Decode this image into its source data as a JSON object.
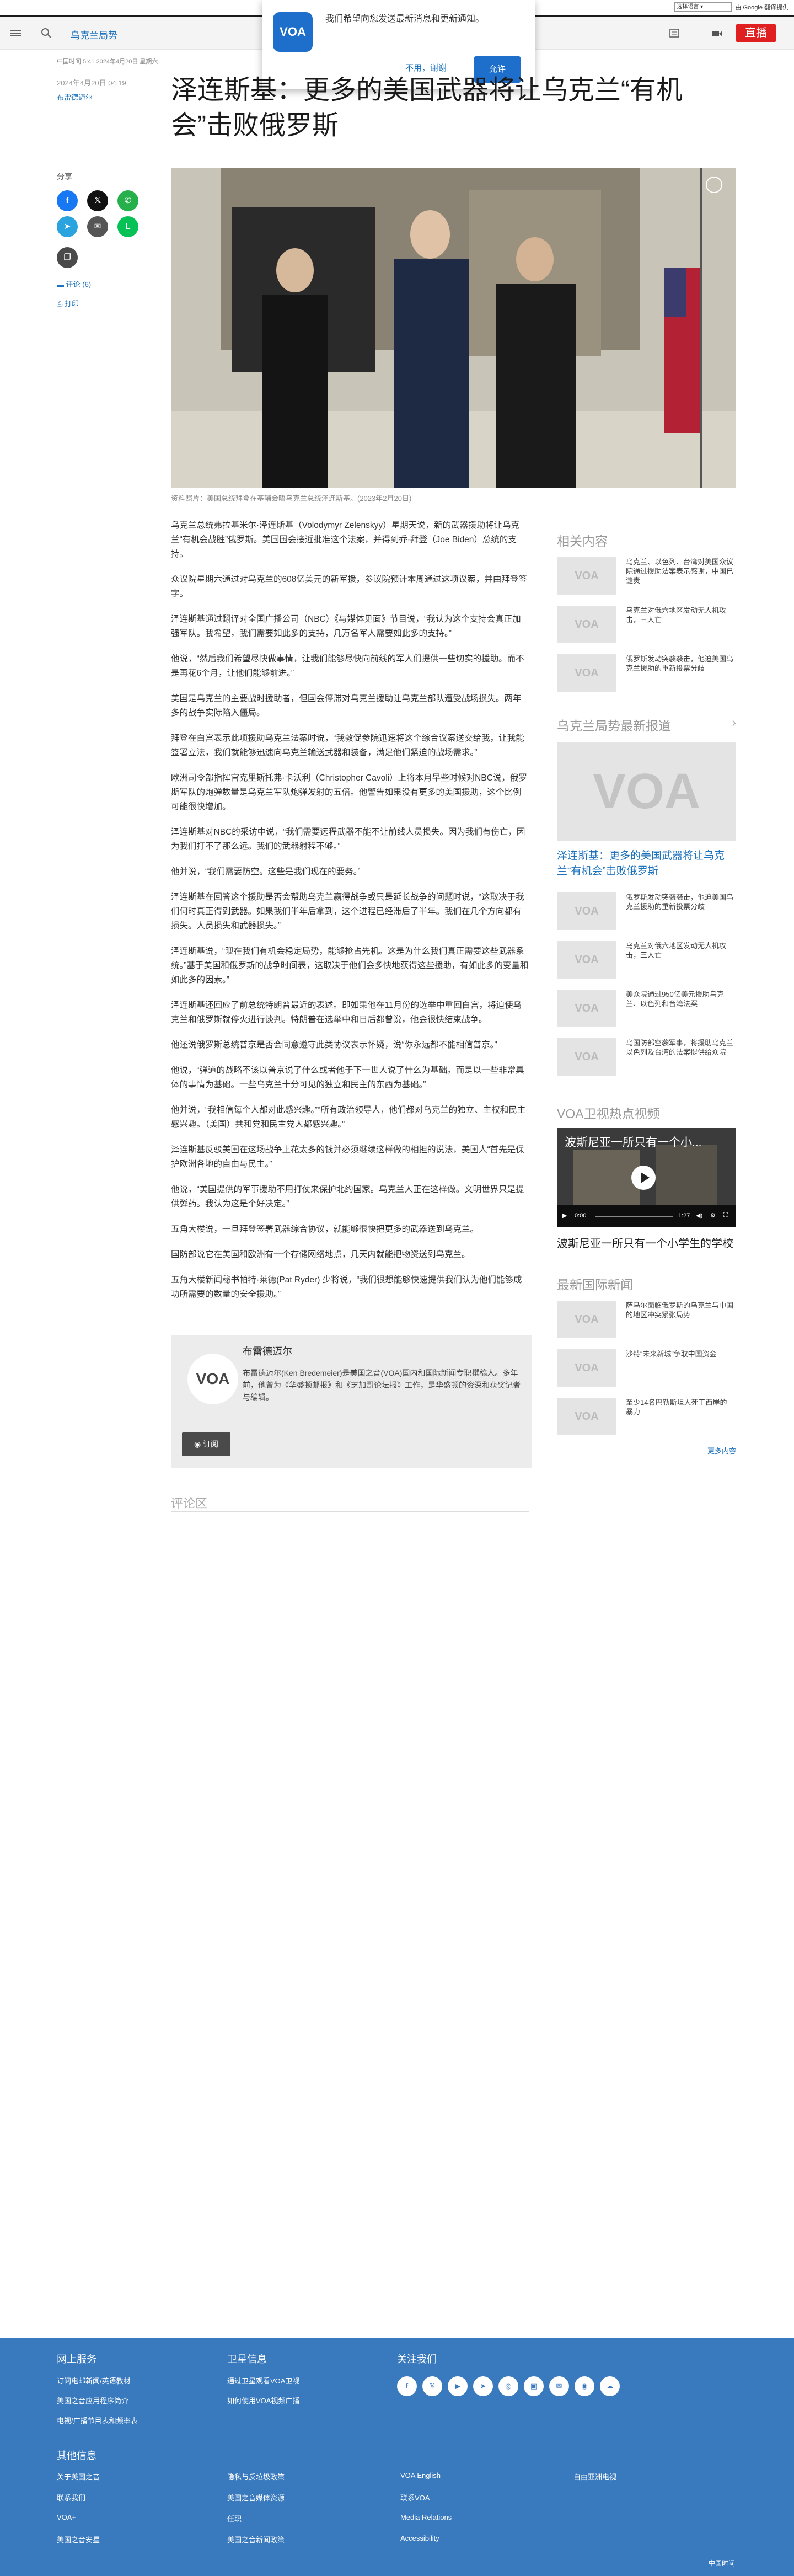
{
  "translate_bar": {
    "select_label": "选择语言",
    "powered": "由 Google 翻译提供"
  },
  "nav": {
    "section": "乌克兰局势",
    "live": "直播"
  },
  "prompt": {
    "logo": "VOA",
    "text": "我们希望向您发送最新消息和更新通知。",
    "deny": "不用，谢谢",
    "allow": "允许"
  },
  "article": {
    "meta_line": "中国时间 5:41 2024年4月20日 星期六",
    "date": "2024年4月20日 04:19",
    "author": "布雷德迈尔",
    "title": "泽连斯基：更多的美国武器将让乌克兰“有机会”击败俄罗斯",
    "share_label": "分享",
    "share_icons": [
      "f",
      "𝕏",
      "✆",
      "➤",
      "✉",
      "L",
      "❐"
    ],
    "comments_link": "评论 (6)",
    "print_link": "打印",
    "image_caption": "资料照片：美国总统拜登在基辅会晤乌克兰总统泽连斯基。(2023年2月20日)",
    "paragraphs": [
      "乌克兰总统弗拉基米尔·泽连斯基（Volodymyr Zelenskyy）星期天说，新的武器援助将让乌克兰“有机会战胜”俄罗斯。美国国会接近批准这个法案，并得到乔·拜登（Joe Biden）总统的支持。",
      "众议院星期六通过对乌克兰的608亿美元的新军援，参议院预计本周通过这项议案，并由拜登签字。",
      "泽连斯基通过翻译对全国广播公司（NBC）《与媒体见面》节目说，“我认为这个支持会真正加强军队。我希望，我们需要如此多的支持，几万名军人需要如此多的支持。”",
      "他说，“然后我们希望尽快做事情，让我们能够尽快向前线的军人们提供一些切实的援助。而不是再花6个月，让他们能够前进。”",
      "美国是乌克兰的主要战时援助者，但国会停滞对乌克兰援助让乌克兰部队遭受战场损失。两年多的战争实际陷入僵局。",
      "拜登在白宫表示此项援助乌克兰法案时说，“我敦促参院迅速将这个综合议案送交给我，让我能签署立法，我们就能够迅速向乌克兰输送武器和装备，满足他们紧迫的战场需求。”",
      "欧洲司令部指挥官克里斯托弗·卡沃利（Christopher Cavoli）上将本月早些时候对NBC说，俄罗斯军队的炮弹数量是乌克兰军队炮弹发射的五倍。他警告如果没有更多的美国援助，这个比例可能很快增加。",
      "泽连斯基对NBC的采访中说，“我们需要远程武器不能不让前线人员损失。因为我们有伤亡，因为我们打不了那么远。我们的武器射程不够。”",
      "他并说，“我们需要防空。这些是我们现在的要务。”",
      "泽连斯基在回答这个援助是否会帮助乌克兰赢得战争或只是延长战争的问题时说，“这取决于我们何时真正得到武器。如果我们半年后拿到，这个进程已经滞后了半年。我们在几个方向都有损失。人员损失和武器损失。”",
      "泽连斯基说，“现在我们有机会稳定局势，能够抢占先机。这是为什么我们真正需要这些武器系统。”基于美国和俄罗斯的战争时间表，这取决于他们会多快地获得这些援助，有如此多的变量和如此多的因素。”",
      "泽连斯基还回应了前总统特朗普最近的表述。即如果他在11月份的选举中重回白宫，将迫使乌克兰和俄罗斯就停火进行谈判。特朗普在选举中和日后都曾说，他会很快结束战争。",
      "他还说俄罗斯总统普京是否会同意遵守此类协议表示怀疑，说“你永远都不能相信普京。”",
      "他说，“弹道的战略不该以普京说了什么或者他于下一世人说了什么为基础。而是以一些非常具体的事情为基础。一些乌克兰十分可见的独立和民主的东西为基础。”",
      "他并说，“我相信每个人都对此感兴趣。”“所有政治领导人，他们都对乌克兰的独立、主权和民主感兴趣。（美国）共和党和民主党人都感兴趣。”",
      "泽连斯基反驳美国在这场战争上花太多的钱并必须继续这样做的相担的说法，美国人“首先是保护欧洲各地的自由与民主。”",
      "他说，“美国提供的军事援助不用打仗来保护北约国家。乌克兰人正在这样做。文明世界只是提供弹药。我认为这是个好决定。”",
      "五角大楼说，一旦拜登签署武器综合协议，就能够很快把更多的武器送到乌克兰。",
      "国防部说它在美国和欧洲有一个存储网络地点，几天内就能把物资送到乌克兰。",
      "五角大楼新闻秘书帕特·莱德(Pat Ryder) 少将说，“我们很想能够快速提供我们认为他们能够成功所需要的数量的安全援助。”"
    ],
    "bio": {
      "name": "布雷德迈尔",
      "text": "布雷德迈尔(Ken Bredemeier)是美国之音(VOA)国内和国际新闻专职撰稿人。多年前，他曾为《华盛顿邮报》和《芝加哥论坛报》工作，是华盛顿的资深和获奖记者与编辑。",
      "subscribe": "订阅"
    },
    "comments_title": "评论区"
  },
  "sidebar": {
    "related_title": "相关内容",
    "related": [
      {
        "thumb": "VOA",
        "title": "乌克兰、以色列、台湾对美国众议院通过援助法案表示感谢，中国已谴责"
      },
      {
        "thumb": "VOA",
        "title": "乌克兰对俄六地区发动无人机攻击，三人亡"
      },
      {
        "thumb": "VOA",
        "title": "俄罗斯发动突袭袭击，他迫美国乌克兰援助的重新投票分歧"
      }
    ],
    "latest_title": "乌克兰局势最新报道",
    "featured": {
      "thumb": "VOA",
      "title": "泽连斯基：更多的美国武器将让乌克兰“有机会”击败俄罗斯"
    },
    "latest": [
      {
        "thumb": "VOA",
        "title": "俄罗斯发动突袭袭击，他迫美国乌克兰援助的重新投票分歧"
      },
      {
        "thumb": "VOA",
        "title": "乌克兰对俄六地区发动无人机攻击，三人亡"
      },
      {
        "thumb": "VOA",
        "title": "美众院通过950亿美元援助乌克兰、以色列和台湾法案"
      },
      {
        "thumb": "VOA",
        "title": "乌国防部空袭军事，将援助乌克兰以色列及台湾的法案提供给众院"
      }
    ],
    "video_title": "VOA卫视热点视频",
    "video": {
      "overlay": "波斯尼亚一所只有一个小...",
      "time": "0:00",
      "duration": "1:27",
      "caption": "波斯尼亚一所只有一个小学生的学校"
    },
    "intl_title": "最新国际新闻",
    "intl": [
      {
        "thumb": "VOA",
        "title": "萨马尔面临俄罗斯的乌克兰与中国的地区冲突紧张局势"
      },
      {
        "thumb": "VOA",
        "title": "沙特“未来新城”争取中国资金"
      },
      {
        "thumb": "VOA",
        "title": "至少14名巴勒斯坦人死于西岸的暴力"
      }
    ],
    "more": "更多内容"
  },
  "footer": {
    "col1_title": "网上服务",
    "col1": [
      "订阅电邮新闻/英语教材",
      "美国之音应用程序简介",
      "电视/广播节目表和频率表"
    ],
    "col2_title": "卫星信息",
    "col2": [
      "通过卫星观看VOA卫视",
      "如何使用VOA视频广播"
    ],
    "col3_title": "关注我们",
    "social": [
      "f",
      "𝕏",
      "▶",
      "➤",
      "◎",
      "▣",
      "✉",
      "◉",
      "☁"
    ],
    "more_title": "其他信息",
    "links": [
      "关于美国之音",
      "联系我们",
      "VOA+",
      "美国之音安星",
      "隐私与反垃圾政策",
      "美国之音媒体资源",
      "任职",
      "美国之音新闻政策",
      "VOA English",
      "联系VOA",
      "Media Relations",
      "Accessibility",
      "自由亚洲电视"
    ],
    "copyright": "中国时间"
  }
}
